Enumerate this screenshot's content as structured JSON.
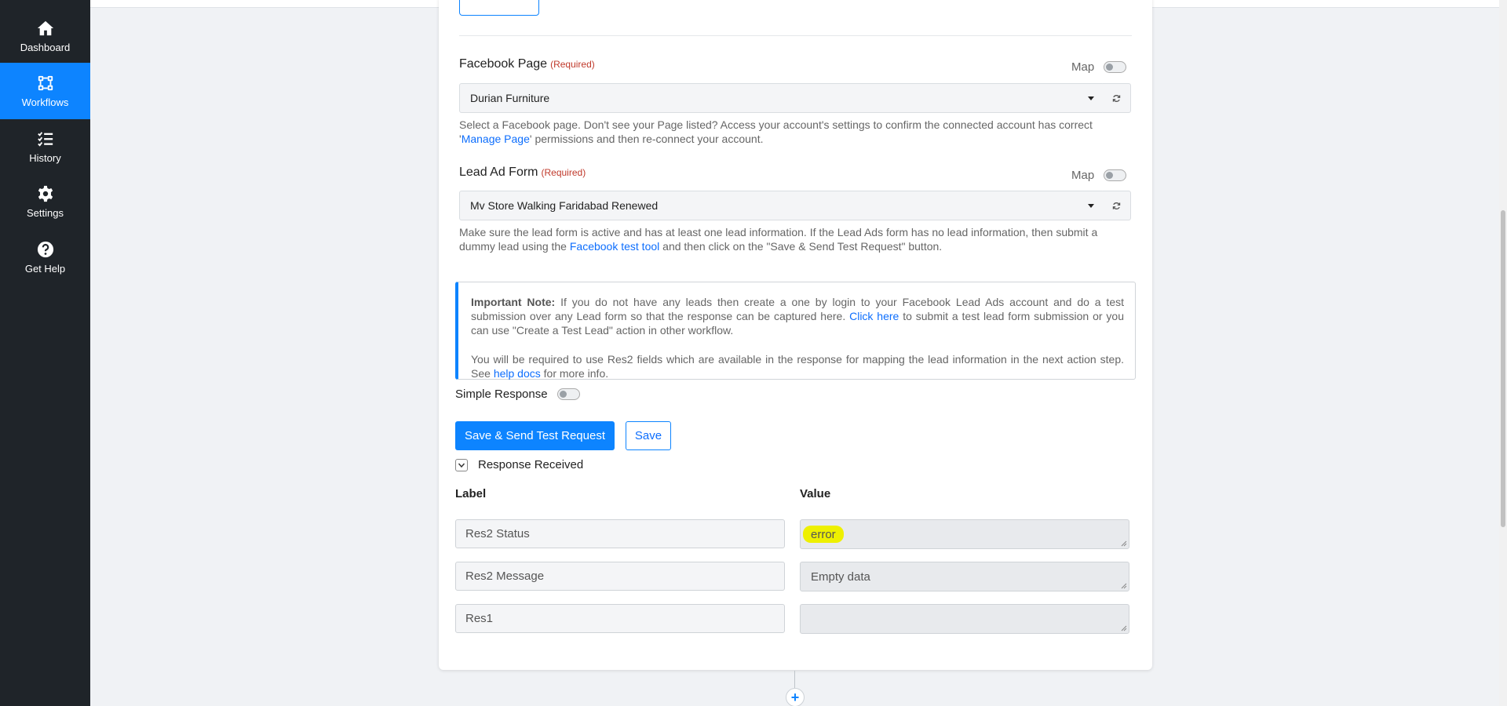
{
  "sidebar": {
    "items": [
      {
        "label": "Dashboard",
        "icon": "home-icon",
        "active": false
      },
      {
        "label": "Workflows",
        "icon": "workflow-icon",
        "active": true
      },
      {
        "label": "History",
        "icon": "list-check-icon",
        "active": false
      },
      {
        "label": "Settings",
        "icon": "gear-icon",
        "active": false
      },
      {
        "label": "Get Help",
        "icon": "question-icon",
        "active": false
      }
    ]
  },
  "facebook_page": {
    "label": "Facebook Page",
    "required": "(Required)",
    "map_label": "Map",
    "value": "Durian Furniture",
    "help_pre": "Select a Facebook page. Don't see your Page listed? Access your account's settings to confirm the connected account has correct '",
    "help_link": "Manage Page",
    "help_post": "' permissions and then re-connect your account."
  },
  "lead_ad_form": {
    "label": "Lead Ad Form",
    "required": "(Required)",
    "map_label": "Map",
    "value": "Mv Store Walking Faridabad Renewed",
    "help_pre": "Make sure the lead form is active and has at least one lead information. If the Lead Ads form has no lead information, then submit a dummy lead using the ",
    "help_link": "Facebook test tool",
    "help_post": " and then click on the \"Save & Send Test Request\" button."
  },
  "note": {
    "title": "Important Note:",
    "p1_pre": " If you do not have any leads then create a one by login to your Facebook Lead Ads account and do a test submission over any Lead form so that the response can be captured here. ",
    "p1_link": "Click here",
    "p1_post": " to submit a test lead form submission or you can use \"Create a Test Lead\" action in other workflow.",
    "p2_pre": "You will be required to use Res2 fields which are available in the response for mapping the lead information in the next action step. See ",
    "p2_link": "help docs",
    "p2_post": " for more info."
  },
  "simple_response": {
    "label": "Simple Response",
    "enabled": false
  },
  "buttons": {
    "send": "Save & Send Test Request",
    "save": "Save"
  },
  "response": {
    "title": "Response Received",
    "label_header": "Label",
    "value_header": "Value",
    "rows": [
      {
        "label": "Res2 Status",
        "value": "error"
      },
      {
        "label": "Res2 Message",
        "value": "Empty data"
      },
      {
        "label": "Res1",
        "value": ""
      }
    ]
  },
  "add_step_symbol": "+",
  "colors": {
    "accent": "#0d84ff",
    "sidebar": "#1f2429",
    "highlight": "#eef000"
  }
}
